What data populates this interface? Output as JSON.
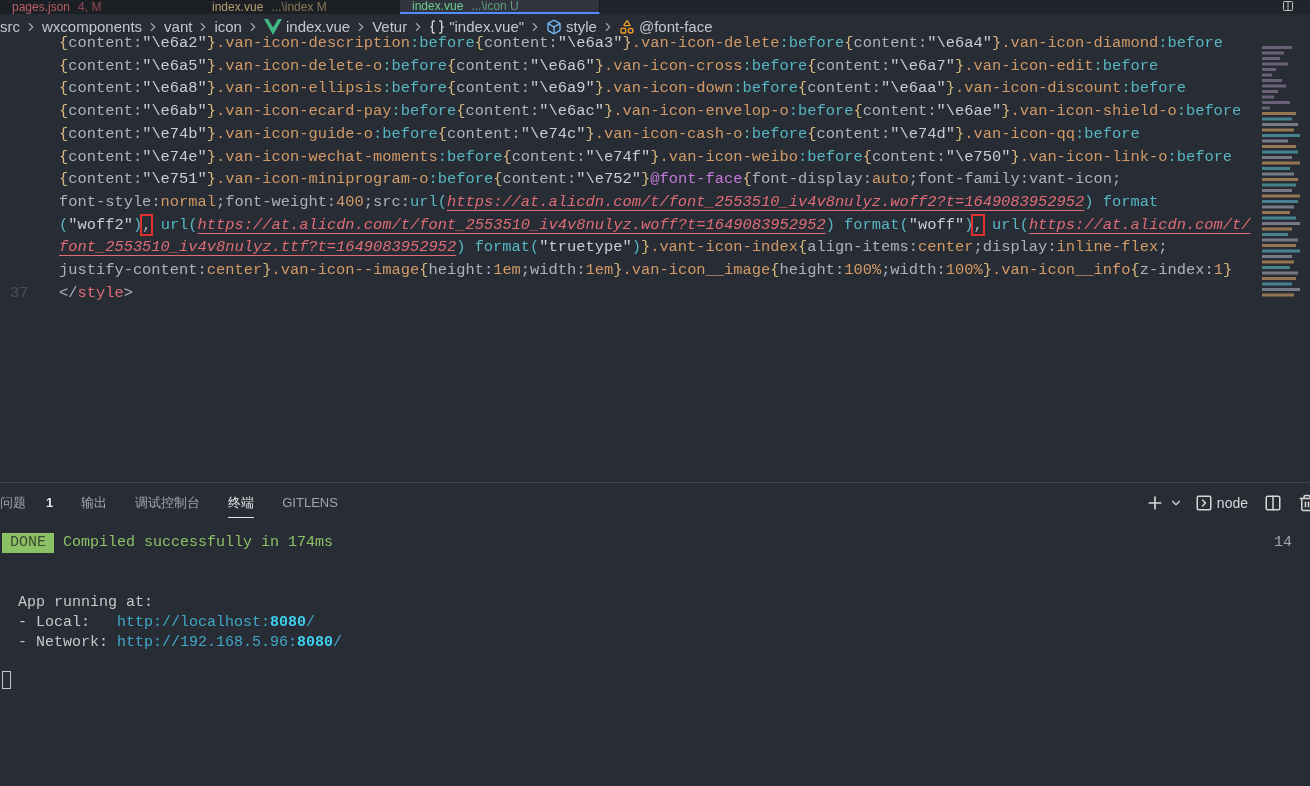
{
  "tabs": [
    {
      "label": "pages.json",
      "detail": "4, M",
      "kind": "error",
      "selected": false
    },
    {
      "label": "index.vue",
      "detail": "...\\index M",
      "kind": "modified",
      "selected": false
    },
    {
      "label": "index.vue",
      "detail": "...\\icon U",
      "kind": "untracked",
      "selected": true
    }
  ],
  "breadcrumb": [
    {
      "label": "src",
      "kind": "folder"
    },
    {
      "label": "wxcomponents",
      "kind": "folder"
    },
    {
      "label": "vant",
      "kind": "folder"
    },
    {
      "label": "icon",
      "kind": "folder"
    },
    {
      "label": "index.vue",
      "kind": "vue"
    },
    {
      "label": "Vetur",
      "kind": "folder"
    },
    {
      "label": "\"index.vue\"",
      "kind": "object"
    },
    {
      "label": "style",
      "kind": "element"
    },
    {
      "label": "@font-face",
      "kind": "symbol"
    }
  ],
  "code_lines": [
    {
      "segments": [
        {
          "kind": "brace",
          "text": "{"
        },
        {
          "kind": "prop",
          "text": "content:"
        },
        {
          "kind": "string",
          "text": "\"\\e6a2\""
        },
        {
          "kind": "brace",
          "text": "}"
        },
        {
          "kind": "selector",
          "text": ".van-icon-description"
        },
        {
          "kind": "pseudo",
          "text": ":before"
        },
        {
          "kind": "brace",
          "text": "{"
        },
        {
          "kind": "prop",
          "text": "content:"
        },
        {
          "kind": "string",
          "text": "\"\\e6a3\""
        },
        {
          "kind": "brace",
          "text": "}"
        },
        {
          "kind": "selector",
          "text": ".van-icon-delete"
        },
        {
          "kind": "pseudo",
          "text": ":before"
        },
        {
          "kind": "brace",
          "text": "{"
        },
        {
          "kind": "prop",
          "text": "content:"
        },
        {
          "kind": "string",
          "text": "\"\\e6a4\""
        },
        {
          "kind": "brace",
          "text": "}"
        },
        {
          "kind": "selector",
          "text": ".van-icon-diamond"
        },
        {
          "kind": "pseudo",
          "text": ":before"
        }
      ]
    },
    {
      "segments": [
        {
          "kind": "brace",
          "text": "{"
        },
        {
          "kind": "prop",
          "text": "content:"
        },
        {
          "kind": "string",
          "text": "\"\\e6a5\""
        },
        {
          "kind": "brace",
          "text": "}"
        },
        {
          "kind": "selector",
          "text": ".van-icon-delete-o"
        },
        {
          "kind": "pseudo",
          "text": ":before"
        },
        {
          "kind": "brace",
          "text": "{"
        },
        {
          "kind": "prop",
          "text": "content:"
        },
        {
          "kind": "string",
          "text": "\"\\e6a6\""
        },
        {
          "kind": "brace",
          "text": "}"
        },
        {
          "kind": "selector",
          "text": ".van-icon-cross"
        },
        {
          "kind": "pseudo",
          "text": ":before"
        },
        {
          "kind": "brace",
          "text": "{"
        },
        {
          "kind": "prop",
          "text": "content:"
        },
        {
          "kind": "string",
          "text": "\"\\e6a7\""
        },
        {
          "kind": "brace",
          "text": "}"
        },
        {
          "kind": "selector",
          "text": ".van-icon-edit"
        },
        {
          "kind": "pseudo",
          "text": ":before"
        }
      ]
    },
    {
      "segments": [
        {
          "kind": "brace",
          "text": "{"
        },
        {
          "kind": "prop",
          "text": "content:"
        },
        {
          "kind": "string",
          "text": "\"\\e6a8\""
        },
        {
          "kind": "brace",
          "text": "}"
        },
        {
          "kind": "selector",
          "text": ".van-icon-ellipsis"
        },
        {
          "kind": "pseudo",
          "text": ":before"
        },
        {
          "kind": "brace",
          "text": "{"
        },
        {
          "kind": "prop",
          "text": "content:"
        },
        {
          "kind": "string",
          "text": "\"\\e6a9\""
        },
        {
          "kind": "brace",
          "text": "}"
        },
        {
          "kind": "selector",
          "text": ".van-icon-down"
        },
        {
          "kind": "pseudo",
          "text": ":before"
        },
        {
          "kind": "brace",
          "text": "{"
        },
        {
          "kind": "prop",
          "text": "content:"
        },
        {
          "kind": "string",
          "text": "\"\\e6aa\""
        },
        {
          "kind": "brace",
          "text": "}"
        },
        {
          "kind": "selector",
          "text": ".van-icon-discount"
        },
        {
          "kind": "pseudo",
          "text": ":before"
        }
      ]
    },
    {
      "segments": [
        {
          "kind": "brace",
          "text": "{"
        },
        {
          "kind": "prop",
          "text": "content:"
        },
        {
          "kind": "string",
          "text": "\"\\e6ab\""
        },
        {
          "kind": "brace",
          "text": "}"
        },
        {
          "kind": "selector",
          "text": ".van-icon-ecard-pay"
        },
        {
          "kind": "pseudo",
          "text": ":before"
        },
        {
          "kind": "brace",
          "text": "{"
        },
        {
          "kind": "prop",
          "text": "content:"
        },
        {
          "kind": "string",
          "text": "\"\\e6ac\""
        },
        {
          "kind": "brace",
          "text": "}"
        },
        {
          "kind": "selector",
          "text": ".van-icon-envelop-o"
        },
        {
          "kind": "pseudo",
          "text": ":before"
        },
        {
          "kind": "brace",
          "text": "{"
        },
        {
          "kind": "prop",
          "text": "content:"
        },
        {
          "kind": "string",
          "text": "\"\\e6ae\""
        },
        {
          "kind": "brace",
          "text": "}"
        },
        {
          "kind": "selector",
          "text": ".van-icon-shield-o"
        },
        {
          "kind": "pseudo",
          "text": ":before"
        }
      ]
    },
    {
      "segments": [
        {
          "kind": "brace",
          "text": "{"
        },
        {
          "kind": "prop",
          "text": "content:"
        },
        {
          "kind": "string",
          "text": "\"\\e74b\""
        },
        {
          "kind": "brace",
          "text": "}"
        },
        {
          "kind": "selector",
          "text": ".van-icon-guide-o"
        },
        {
          "kind": "pseudo",
          "text": ":before"
        },
        {
          "kind": "brace",
          "text": "{"
        },
        {
          "kind": "prop",
          "text": "content:"
        },
        {
          "kind": "string",
          "text": "\"\\e74c\""
        },
        {
          "kind": "brace",
          "text": "}"
        },
        {
          "kind": "selector",
          "text": ".van-icon-cash-o"
        },
        {
          "kind": "pseudo",
          "text": ":before"
        },
        {
          "kind": "brace",
          "text": "{"
        },
        {
          "kind": "prop",
          "text": "content:"
        },
        {
          "kind": "string",
          "text": "\"\\e74d\""
        },
        {
          "kind": "brace",
          "text": "}"
        },
        {
          "kind": "selector",
          "text": ".van-icon-qq"
        },
        {
          "kind": "pseudo",
          "text": ":before"
        }
      ]
    },
    {
      "segments": [
        {
          "kind": "brace",
          "text": "{"
        },
        {
          "kind": "prop",
          "text": "content:"
        },
        {
          "kind": "string",
          "text": "\"\\e74e\""
        },
        {
          "kind": "brace",
          "text": "}"
        },
        {
          "kind": "selector",
          "text": ".van-icon-wechat-moments"
        },
        {
          "kind": "pseudo",
          "text": ":before"
        },
        {
          "kind": "brace",
          "text": "{"
        },
        {
          "kind": "prop",
          "text": "content:"
        },
        {
          "kind": "string",
          "text": "\"\\e74f\""
        },
        {
          "kind": "brace",
          "text": "}"
        },
        {
          "kind": "selector",
          "text": ".van-icon-weibo"
        },
        {
          "kind": "pseudo",
          "text": ":before"
        },
        {
          "kind": "brace",
          "text": "{"
        },
        {
          "kind": "prop",
          "text": "content:"
        },
        {
          "kind": "string",
          "text": "\"\\e750\""
        },
        {
          "kind": "brace",
          "text": "}"
        },
        {
          "kind": "selector",
          "text": ".van-icon-link-o"
        },
        {
          "kind": "pseudo",
          "text": ":before"
        }
      ]
    },
    {
      "segments": [
        {
          "kind": "brace",
          "text": "{"
        },
        {
          "kind": "prop",
          "text": "content:"
        },
        {
          "kind": "string",
          "text": "\"\\e751\""
        },
        {
          "kind": "brace",
          "text": "}"
        },
        {
          "kind": "selector",
          "text": ".van-icon-miniprogram-o"
        },
        {
          "kind": "pseudo",
          "text": ":before"
        },
        {
          "kind": "brace",
          "text": "{"
        },
        {
          "kind": "prop",
          "text": "content:"
        },
        {
          "kind": "string",
          "text": "\"\\e752\""
        },
        {
          "kind": "brace",
          "text": "}"
        },
        {
          "kind": "atrule",
          "text": "@font-face"
        },
        {
          "kind": "brace",
          "text": "{"
        },
        {
          "kind": "prop",
          "text": "font-display:"
        },
        {
          "kind": "value",
          "text": "auto"
        },
        {
          "kind": "prop",
          "text": ";font-family:vant-icon;"
        }
      ]
    },
    {
      "segments": [
        {
          "kind": "prop",
          "text": "font-style:"
        },
        {
          "kind": "value",
          "text": "normal"
        },
        {
          "kind": "prop",
          "text": ";font-weight:"
        },
        {
          "kind": "value",
          "text": "400"
        },
        {
          "kind": "prop",
          "text": ";src:"
        },
        {
          "kind": "func",
          "text": "url("
        },
        {
          "kind": "link",
          "text": "https://at.alicdn.com/t/font_2553510_iv4v8nulyz.woff2?t=1649083952952"
        },
        {
          "kind": "func",
          "text": ") format"
        }
      ]
    },
    {
      "segments": [
        {
          "kind": "func",
          "text": "("
        },
        {
          "kind": "string",
          "text": "\"woff2\""
        },
        {
          "kind": "func",
          "text": ")"
        },
        {
          "kind": "boxed",
          "text": ","
        },
        {
          "kind": "func",
          "text": " url("
        },
        {
          "kind": "link",
          "text": "https://at.alicdn.com/t/font_2553510_iv4v8nulyz.woff?t=1649083952952"
        },
        {
          "kind": "func",
          "text": ") format("
        },
        {
          "kind": "string",
          "text": "\"woff\""
        },
        {
          "kind": "func",
          "text": ")"
        },
        {
          "kind": "boxed",
          "text": ","
        },
        {
          "kind": "func",
          "text": " url("
        },
        {
          "kind": "link",
          "text": "https://at.alicdn.com/t/"
        }
      ]
    },
    {
      "segments": [
        {
          "kind": "link",
          "text": "font_2553510_iv4v8nulyz.ttf?t=1649083952952"
        },
        {
          "kind": "func",
          "text": ") format("
        },
        {
          "kind": "string",
          "text": "\"truetype\""
        },
        {
          "kind": "func",
          "text": ")"
        },
        {
          "kind": "brace",
          "text": "}"
        },
        {
          "kind": "selector",
          "text": ".vant-icon-index"
        },
        {
          "kind": "brace",
          "text": "{"
        },
        {
          "kind": "prop",
          "text": "align-items:"
        },
        {
          "kind": "value",
          "text": "center"
        },
        {
          "kind": "prop",
          "text": ";display:"
        },
        {
          "kind": "value",
          "text": "inline-flex"
        },
        {
          "kind": "prop",
          "text": ";"
        }
      ]
    },
    {
      "segments": [
        {
          "kind": "prop",
          "text": "justify-content:"
        },
        {
          "kind": "value",
          "text": "center"
        },
        {
          "kind": "brace",
          "text": "}"
        },
        {
          "kind": "selector",
          "text": ".van-icon--image"
        },
        {
          "kind": "brace",
          "text": "{"
        },
        {
          "kind": "prop",
          "text": "height:"
        },
        {
          "kind": "value",
          "text": "1em"
        },
        {
          "kind": "prop",
          "text": ";width:"
        },
        {
          "kind": "value",
          "text": "1em"
        },
        {
          "kind": "brace",
          "text": "}"
        },
        {
          "kind": "selector",
          "text": ".van-icon__image"
        },
        {
          "kind": "brace",
          "text": "{"
        },
        {
          "kind": "prop",
          "text": "height:"
        },
        {
          "kind": "value",
          "text": "100%"
        },
        {
          "kind": "prop",
          "text": ";width:"
        },
        {
          "kind": "value",
          "text": "100%"
        },
        {
          "kind": "brace",
          "text": "}"
        },
        {
          "kind": "selector",
          "text": ".van-icon__info"
        },
        {
          "kind": "brace",
          "text": "{"
        },
        {
          "kind": "prop",
          "text": "z-index:"
        },
        {
          "kind": "value",
          "text": "1"
        },
        {
          "kind": "brace",
          "text": "}"
        }
      ]
    },
    {
      "number": "37",
      "segments": [
        {
          "kind": "prop",
          "text": "</"
        },
        {
          "kind": "tag",
          "text": "style"
        },
        {
          "kind": "prop",
          "text": ">"
        }
      ]
    }
  ],
  "panel_tabs": [
    {
      "label": "问题",
      "badge": "1",
      "selected": false
    },
    {
      "label": "输出",
      "selected": false
    },
    {
      "label": "调试控制台",
      "selected": false
    },
    {
      "label": "终端",
      "selected": true
    },
    {
      "label": "GITLENS",
      "selected": false
    }
  ],
  "terminal_profile": "node",
  "terminal": {
    "status_badge": "DONE",
    "status_text": "Compiled successfully in 174ms",
    "right_text": "14",
    "lines": [
      {
        "segments": [
          {
            "kind": "plain",
            "text": "  App running at:"
          }
        ]
      },
      {
        "segments": [
          {
            "kind": "plain",
            "text": "  - Local:   "
          },
          {
            "kind": "url",
            "text": "http://localhost:"
          },
          {
            "kind": "port",
            "text": "8080"
          },
          {
            "kind": "url",
            "text": "/"
          }
        ]
      },
      {
        "segments": [
          {
            "kind": "plain",
            "text": "  - Network: "
          },
          {
            "kind": "url",
            "text": "http://192.168.5.96:"
          },
          {
            "kind": "port",
            "text": "8080"
          },
          {
            "kind": "url",
            "text": "/"
          }
        ]
      }
    ]
  }
}
